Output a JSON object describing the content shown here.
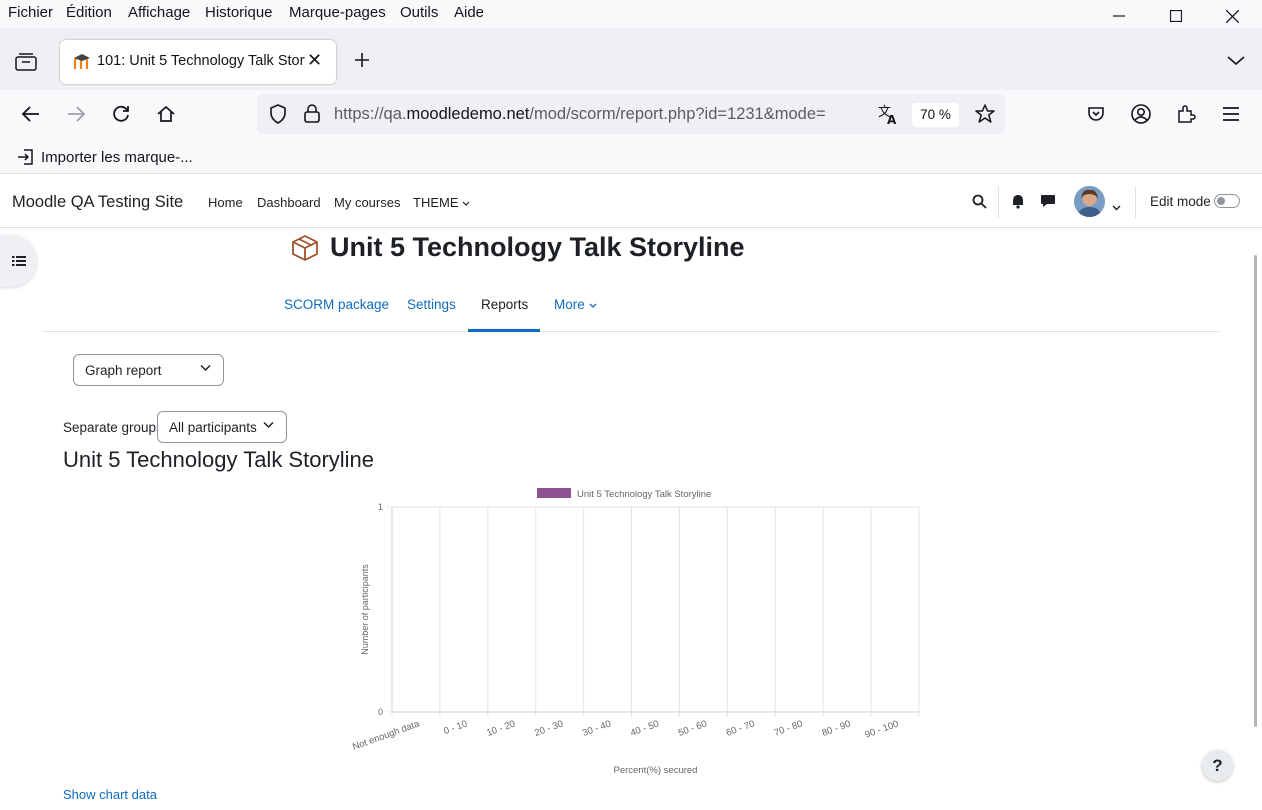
{
  "browser": {
    "menu": [
      "Fichier",
      "Édition",
      "Affichage",
      "Historique",
      "Marque-pages",
      "Outils",
      "Aide"
    ],
    "tab_title": "101: Unit 5 Technology Talk Storyline",
    "url_prefix": "https://qa.",
    "url_host": "moodledemo.net",
    "url_path": "/mod/scorm/report.php?id=1231&mode=",
    "zoom": "70 %",
    "bookmark_label": "Importer les marque-..."
  },
  "moodle": {
    "site_name": "Moodle QA Testing Site",
    "primary_nav": [
      "Home",
      "Dashboard",
      "My courses",
      "THEME"
    ],
    "edit_mode_label": "Edit mode",
    "page_title": "Unit 5 Technology Talk Storyline",
    "secondary_nav": [
      "SCORM package",
      "Settings",
      "Reports",
      "More"
    ],
    "report_select": "Graph report",
    "groups_label": "Separate groups",
    "groups_select": "All participants",
    "report_heading": "Unit 5 Technology Talk Storyline",
    "show_chart_data": "Show chart data",
    "help": "?"
  },
  "colors": {
    "link": "#0f6cbf",
    "series": "#8c5291"
  },
  "chart_data": {
    "type": "bar",
    "categories": [
      "Not enough data",
      "0 - 10",
      "10 - 20",
      "20 - 30",
      "30 - 40",
      "40 - 50",
      "50 - 60",
      "60 - 70",
      "70 - 80",
      "80 - 90",
      "90 - 100"
    ],
    "series": [
      {
        "name": "Unit 5 Technology Talk Storyline",
        "values": [
          0,
          0,
          0,
          0,
          0,
          0,
          0,
          0,
          0,
          0,
          0
        ]
      }
    ],
    "xlabel": "Percent(%) secured",
    "ylabel": "Number of participants",
    "ylim": [
      0,
      1
    ],
    "yticks": [
      "0",
      "1"
    ],
    "legend": "top",
    "grid": true
  }
}
